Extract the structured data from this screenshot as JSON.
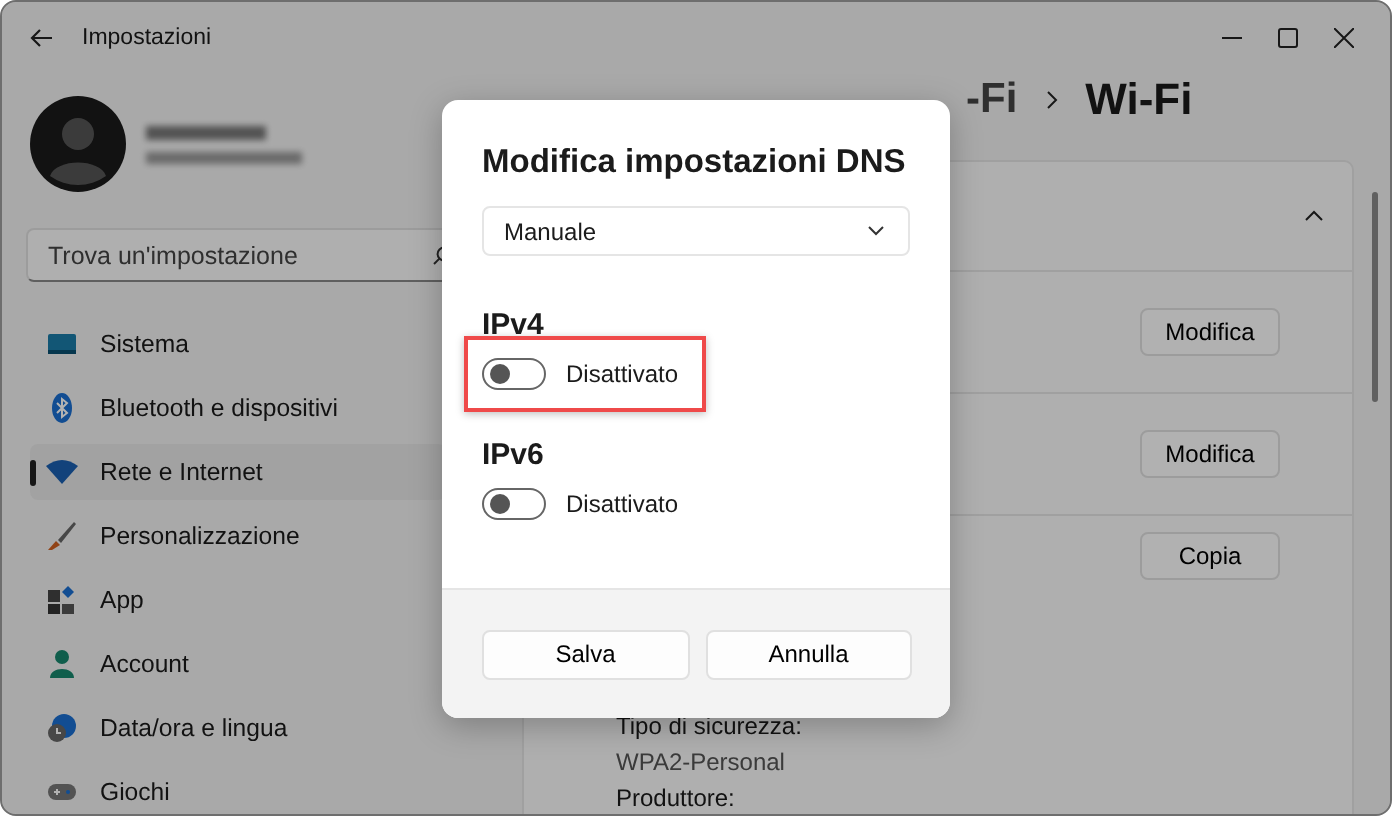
{
  "window": {
    "title": "Impostazioni"
  },
  "search": {
    "placeholder": "Trova un'impostazione"
  },
  "sidebar": {
    "items": [
      {
        "label": "Sistema",
        "selected": false
      },
      {
        "label": "Bluetooth e dispositivi",
        "selected": false
      },
      {
        "label": "Rete e Internet",
        "selected": true
      },
      {
        "label": "Personalizzazione",
        "selected": false
      },
      {
        "label": "App",
        "selected": false
      },
      {
        "label": "Account",
        "selected": false
      },
      {
        "label": "Data/ora e lingua",
        "selected": false
      },
      {
        "label": "Giochi",
        "selected": false
      }
    ]
  },
  "breadcrumb": {
    "parent": "-Fi",
    "current": "Wi-Fi"
  },
  "card": {
    "expanded": true,
    "buttons": [
      "Modifica",
      "Modifica",
      "Copia"
    ],
    "properties": [
      {
        "label": "Tipo di sicurezza:",
        "value": "WPA2-Personal"
      },
      {
        "label": "Produttore:"
      }
    ]
  },
  "dialog": {
    "title": "Modifica impostazioni DNS",
    "dropdown": {
      "value": "Manuale"
    },
    "sections": [
      {
        "heading": "IPv4",
        "toggle": {
          "on": false,
          "label": "Disattivato"
        },
        "highlighted": true
      },
      {
        "heading": "IPv6",
        "toggle": {
          "on": false,
          "label": "Disattivato"
        },
        "highlighted": false
      }
    ],
    "buttons": [
      "Salva",
      "Annulla"
    ]
  }
}
